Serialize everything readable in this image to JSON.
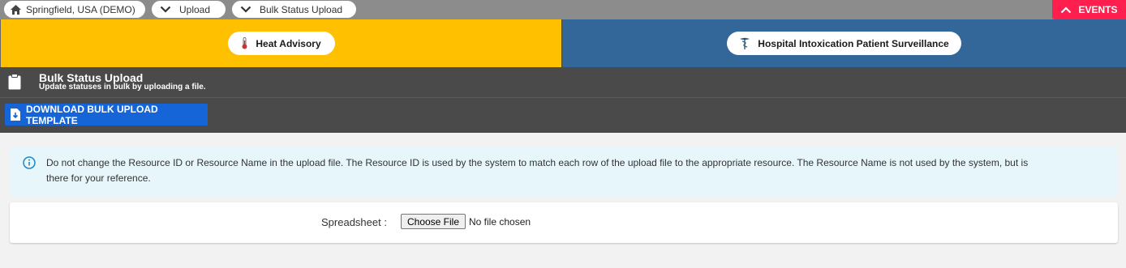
{
  "breadcrumbs": {
    "location": "Springfield, USA (DEMO)",
    "upload": "Upload",
    "bulk": "Bulk Status Upload"
  },
  "events_label": "EVENTS",
  "banners": {
    "heat": "Heat Advisory",
    "hospital": "Hospital Intoxication Patient Surveillance"
  },
  "page": {
    "title": "Bulk Status Upload",
    "subtitle": "Update statuses in bulk by uploading a file."
  },
  "toolbar": {
    "download_label": "DOWNLOAD BULK UPLOAD TEMPLATE"
  },
  "info": {
    "line1": "Do not change the Resource ID or Resource Name in the upload file. The Resource ID is used by the system to match each row of the upload file to the appropriate resource. The Resource Name is not used by the system, but is",
    "line2": "there for your reference."
  },
  "upload": {
    "label": "Spreadsheet :",
    "button": "Choose File",
    "status": "No file chosen"
  },
  "colors": {
    "topbar": "#8c8c8c",
    "events": "#ff1f4f",
    "heat": "#ffc000",
    "hospital": "#336699",
    "header": "#4a4a4a",
    "primary": "#1565d8",
    "info_bg": "#e6f6fb"
  },
  "icons": {
    "home": "home-icon",
    "chevron": "chevron-down-icon",
    "events": "chevron-up-icon",
    "heat": "thermometer-icon",
    "hospital": "caduceus-icon",
    "page": "clipboard-icon",
    "download": "file-download-icon",
    "info": "info-icon"
  }
}
